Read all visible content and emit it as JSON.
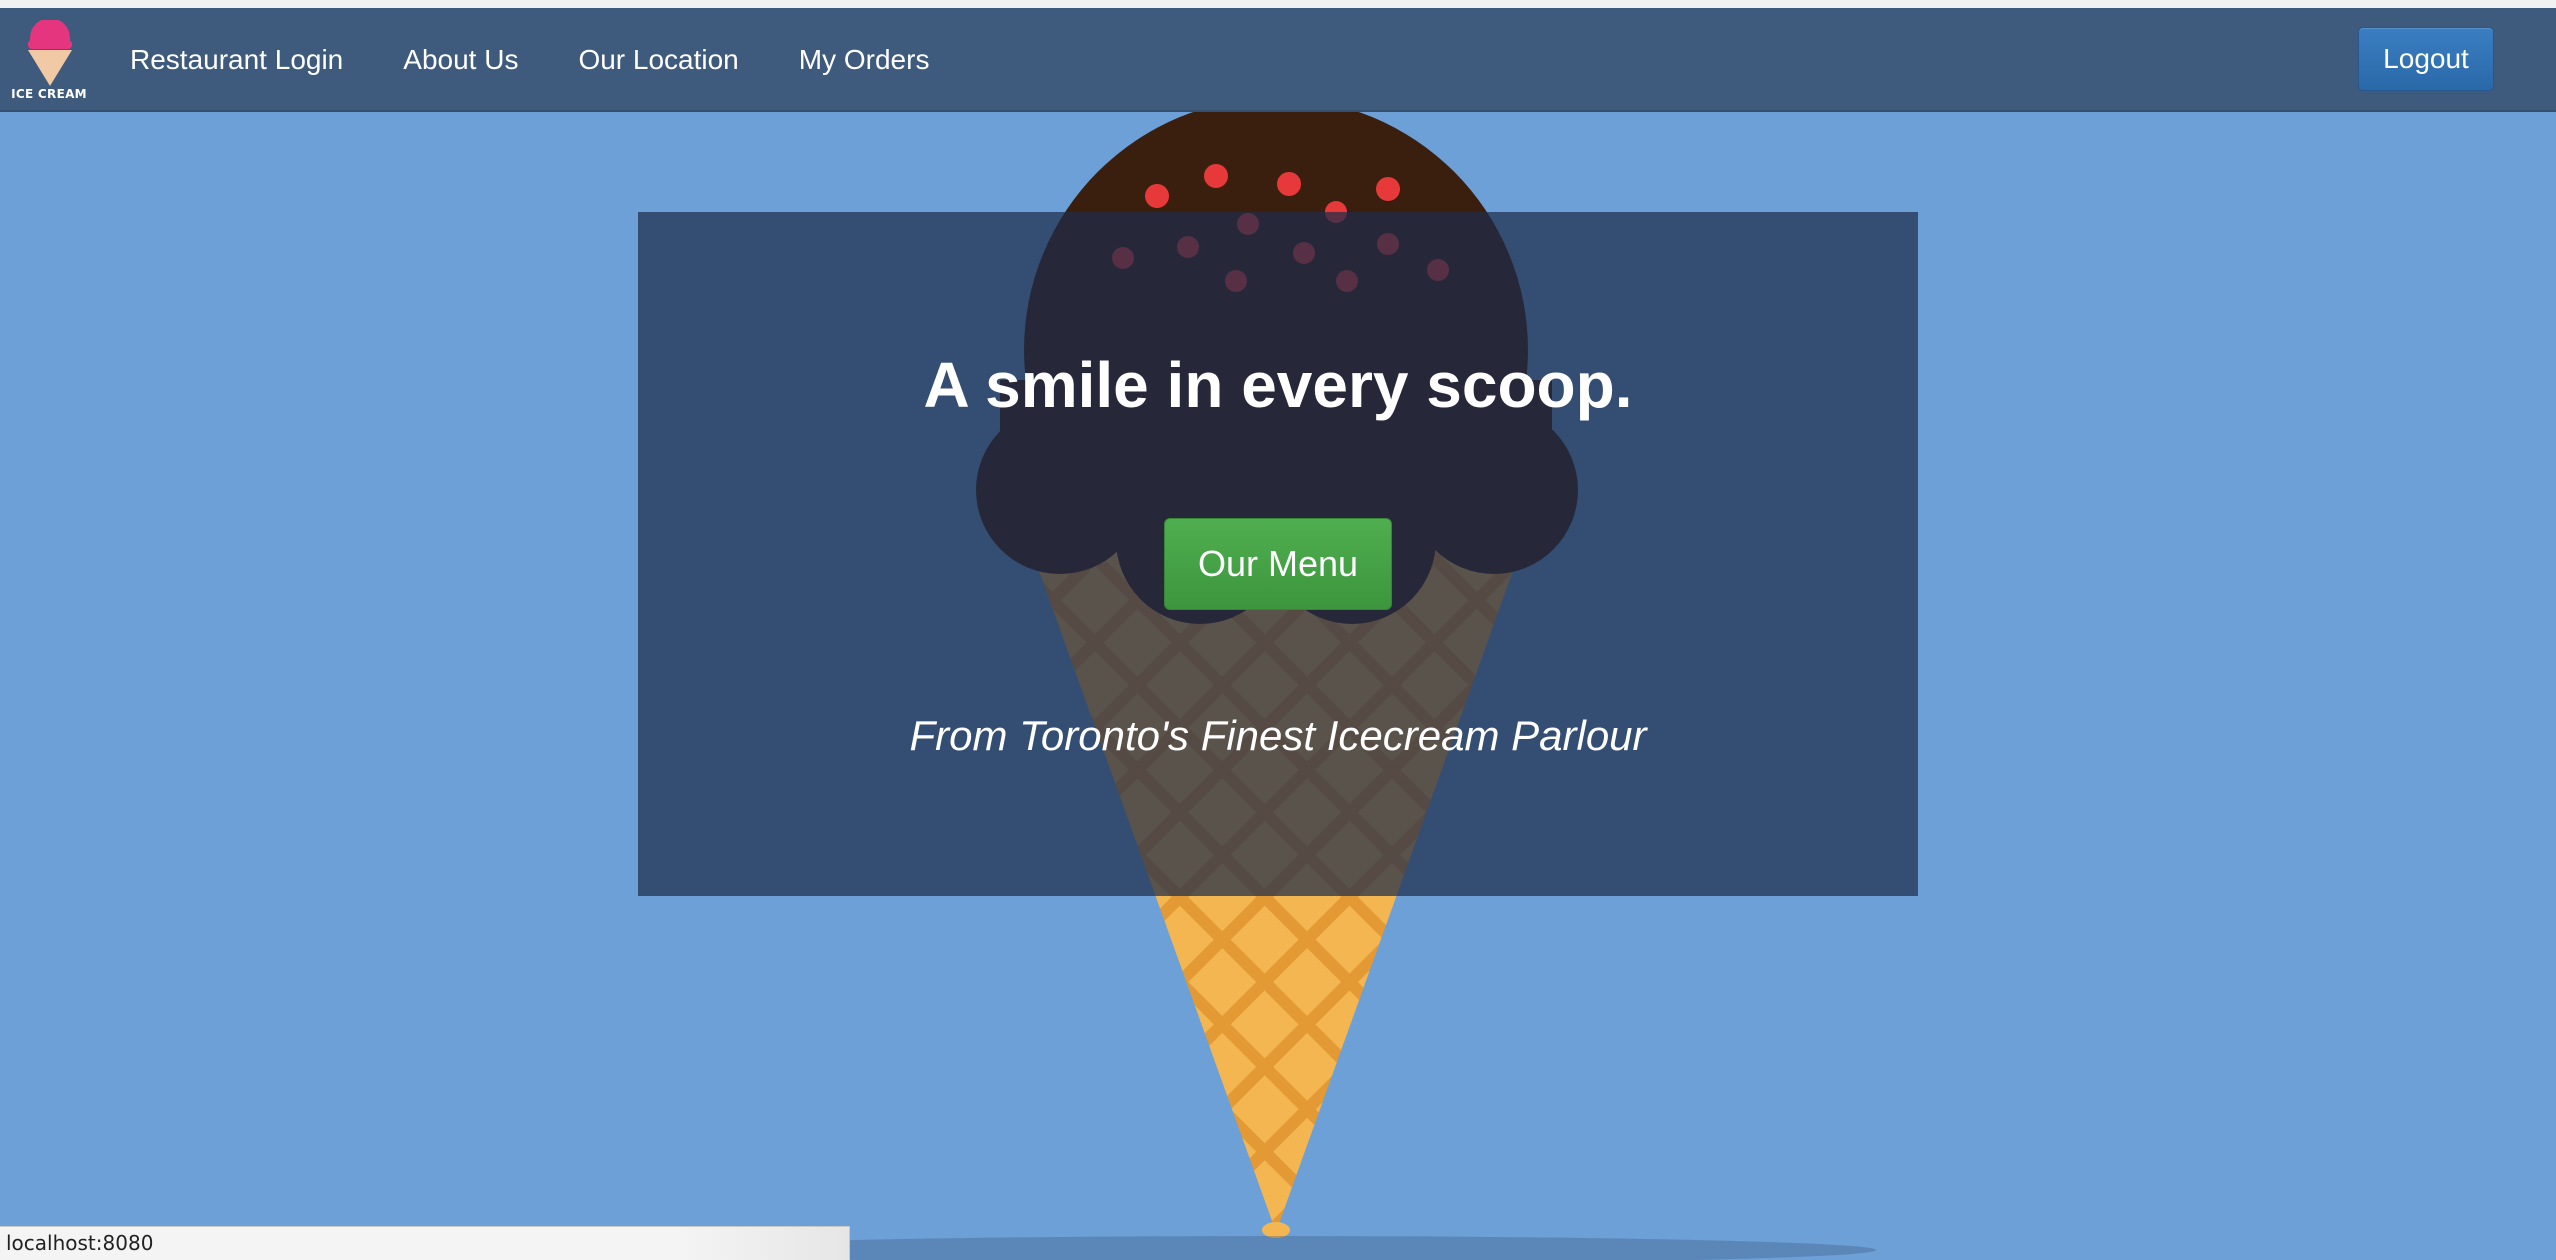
{
  "logo": {
    "text": "ICE CREAM",
    "icon": "ice-cream-cone-logo"
  },
  "nav": {
    "links": [
      {
        "label": "Restaurant Login"
      },
      {
        "label": "About Us"
      },
      {
        "label": "Our Location"
      },
      {
        "label": "My Orders"
      }
    ],
    "logout_label": "Logout"
  },
  "hero": {
    "title": "A smile in every scoop.",
    "menu_button_label": "Our Menu",
    "tagline": "From Toronto's Finest Icecream Parlour"
  },
  "status_bar": {
    "url": "localhost:8080"
  },
  "colors": {
    "page_background": "#6ca0d6",
    "navbar": "#3e5a7c",
    "logout_button": "#2f72b6",
    "menu_button": "#46a246",
    "scoop": "#3b1f0e",
    "cone": "#f4b651",
    "sprinkles": "#e8393a"
  }
}
